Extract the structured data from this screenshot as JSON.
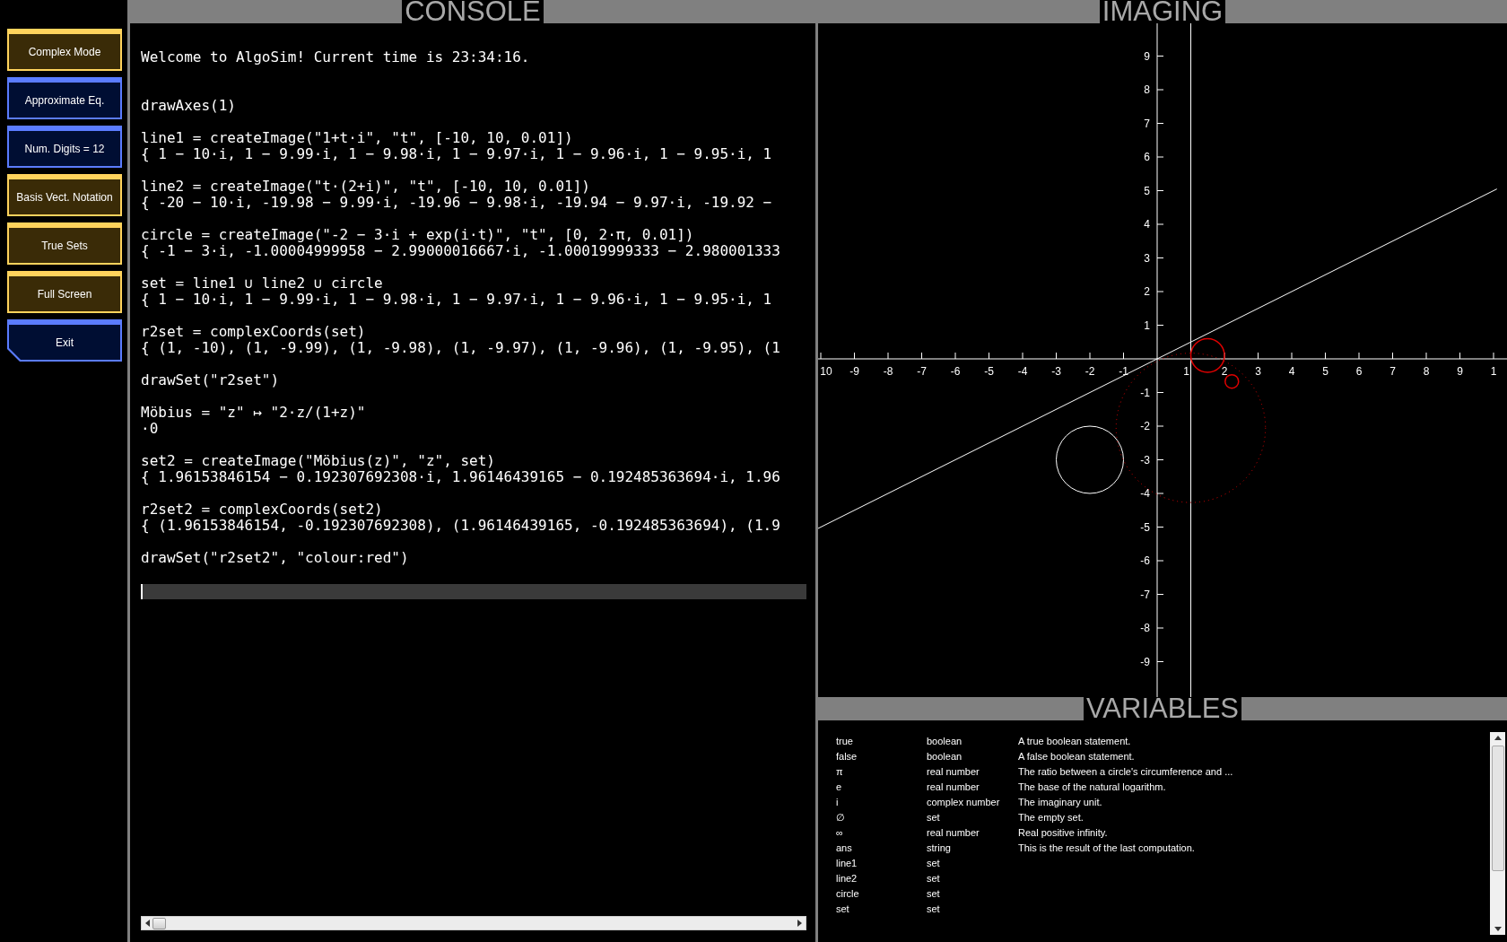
{
  "sidebar": {
    "buttons": [
      {
        "label": "Complex Mode",
        "on": true,
        "kind": "toggle"
      },
      {
        "label": "Approximate Eq.",
        "on": false,
        "kind": "toggle"
      },
      {
        "label": "Num. Digits = 12",
        "on": false,
        "kind": "toggle"
      },
      {
        "label": "Basis Vect. Notation",
        "on": true,
        "kind": "toggle"
      },
      {
        "label": "True Sets",
        "on": true,
        "kind": "toggle"
      },
      {
        "label": "Full Screen",
        "on": true,
        "kind": "toggle"
      },
      {
        "label": "Exit",
        "on": false,
        "kind": "exit"
      }
    ]
  },
  "console": {
    "title": "CONSOLE",
    "welcome": "Welcome to AlgoSim! Current time is 23:34:16.",
    "entries": [
      {
        "input": "drawAxes(1)"
      },
      {
        "input": "line1 = createImage(\"1+t·i\", \"t\", [-10, 10, 0.01])",
        "output": "{ 1 − 10·i, 1 − 9.99·i, 1 − 9.98·i, 1 − 9.97·i, 1 − 9.96·i, 1 − 9.95·i, 1"
      },
      {
        "input": "line2 = createImage(\"t·(2+i)\", \"t\", [-10, 10, 0.01])",
        "output": "{ -20 − 10·i, -19.98 − 9.99·i, -19.96 − 9.98·i, -19.94 − 9.97·i, -19.92 −"
      },
      {
        "input": "circle = createImage(\"-2 − 3·i + exp(i·t)\", \"t\", [0, 2·π, 0.01])",
        "output": "{ -1 − 3·i, -1.00004999958 − 2.99000016667·i, -1.00019999333 − 2.980001333"
      },
      {
        "input": "set = line1 ∪ line2 ∪ circle",
        "output": "{ 1 − 10·i, 1 − 9.99·i, 1 − 9.98·i, 1 − 9.97·i, 1 − 9.96·i, 1 − 9.95·i, 1"
      },
      {
        "input": "r2set = complexCoords(set)",
        "output": "{ (1, -10), (1, -9.99), (1, -9.98), (1, -9.97), (1, -9.96), (1, -9.95), (1"
      },
      {
        "input": "drawSet(\"r2set\")"
      },
      {
        "input": "Möbius = \"z\" ↦ \"2·z/(1+z)\"",
        "output": "·0"
      },
      {
        "input": "set2 = createImage(\"Möbius(z)\", \"z\", set)",
        "output": "{ 1.96153846154 − 0.192307692308·i, 1.96146439165 − 0.192485363694·i, 1.96"
      },
      {
        "input": "r2set2 = complexCoords(set2)",
        "output": "{ (1.96153846154, -0.192307692308), (1.96146439165, -0.192485363694), (1.9"
      },
      {
        "input": "drawSet(\"r2set2\", \"colour:red\")"
      }
    ]
  },
  "imaging": {
    "title": "IMAGING",
    "xticks": [
      "10",
      "-9",
      "-8",
      "-7",
      "-6",
      "-5",
      "-4",
      "-3",
      "-2",
      "-1",
      "1",
      "2",
      "3",
      "4",
      "5",
      "6",
      "7",
      "8",
      "9",
      "1"
    ],
    "yticks": [
      "9",
      "8",
      "7",
      "6",
      "5",
      "4",
      "3",
      "2",
      "1",
      "-1",
      "-2",
      "-3",
      "-4",
      "-5",
      "-6",
      "-7",
      "-8",
      "-9"
    ]
  },
  "variables": {
    "title": "VARIABLES",
    "rows": [
      {
        "name": "true",
        "type": "boolean",
        "description": "A true boolean statement."
      },
      {
        "name": "false",
        "type": "boolean",
        "description": "A false boolean statement."
      },
      {
        "name": "π",
        "type": "real number",
        "description": "The ratio between a circle's circumference and ..."
      },
      {
        "name": "e",
        "type": "real number",
        "description": "The base of the natural logarithm."
      },
      {
        "name": "i",
        "type": "complex number",
        "description": "The imaginary unit."
      },
      {
        "name": "∅",
        "type": "set",
        "description": "The empty set."
      },
      {
        "name": "∞",
        "type": "real number",
        "description": "Real positive infinity."
      },
      {
        "name": "ans",
        "type": "string",
        "description": "This is the result of the last computation."
      },
      {
        "name": "line1",
        "type": "set"
      },
      {
        "name": "line2",
        "type": "set"
      },
      {
        "name": "circle",
        "type": "set"
      },
      {
        "name": "set",
        "type": "set"
      }
    ]
  }
}
